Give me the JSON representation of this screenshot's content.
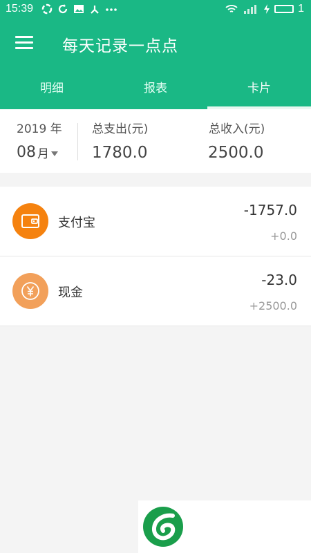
{
  "status_bar": {
    "time": "15:39",
    "battery": "1"
  },
  "app_bar": {
    "title": "每天记录一点点"
  },
  "tabs": [
    {
      "label": "明细",
      "active": false
    },
    {
      "label": "报表",
      "active": false
    },
    {
      "label": "卡片",
      "active": true
    }
  ],
  "summary": {
    "year": "2019 年",
    "month": "08",
    "month_unit": "月",
    "expense_label": "总支出(元)",
    "expense_value": "1780.0",
    "income_label": "总收入(元)",
    "income_value": "2500.0"
  },
  "cards": [
    {
      "name": "支付宝",
      "expense": "-1757.0",
      "income": "+0.0",
      "icon": "wallet-icon",
      "color": "#f5820f"
    },
    {
      "name": "现金",
      "expense": "-23.0",
      "income": "+2500.0",
      "icon": "yuan-coin-icon",
      "color": "#f2a05a"
    }
  ],
  "colors": {
    "primary": "#1ab885",
    "alipay": "#f5820f",
    "cash": "#f2a05a"
  }
}
